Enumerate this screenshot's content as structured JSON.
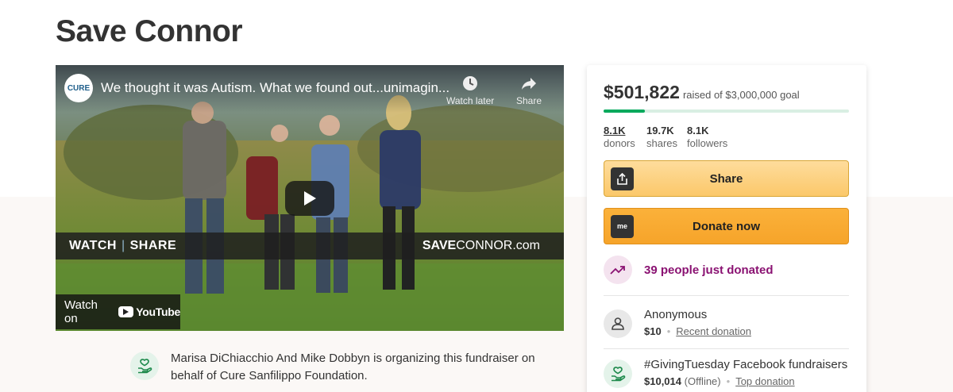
{
  "page": {
    "title": "Save Connor"
  },
  "video": {
    "channel_logo_text": "CURE",
    "title": "We thought it was Autism. What we found out...unimagin...",
    "watch_later": "Watch later",
    "share": "Share",
    "banner_watch": "WATCH",
    "banner_share": "SHARE",
    "banner_site_bold": "SAVE",
    "banner_site_rest": "CONNOR.com",
    "watch_on": "Watch on",
    "youtube": "YouTube"
  },
  "organizer": {
    "text": "Marisa DiChiacchio And Mike Dobbyn is organizing this fundraiser on behalf of Cure Sanfilippo Foundation."
  },
  "sidebar": {
    "raised_amount": "$501,822",
    "goal_text": "raised of $3,000,000 goal",
    "progress_fraction": 0.167,
    "stats": [
      {
        "value": "8.1K",
        "label": "donors"
      },
      {
        "value": "19.7K",
        "label": "shares"
      },
      {
        "value": "8.1K",
        "label": "followers"
      }
    ],
    "share_label": "Share",
    "donate_label": "Donate now",
    "donate_icon_text": "me",
    "recent_count_text": "39 people just donated",
    "donations": [
      {
        "name": "Anonymous",
        "amount": "$10",
        "note": "",
        "tag": "Recent donation"
      },
      {
        "name": "#GivingTuesday Facebook fundraisers",
        "amount": "$10,014",
        "note": "(Offline)",
        "tag": "Top donation"
      }
    ]
  },
  "colors": {
    "brand_green": "#02a95c",
    "share_button": "#fbc86a",
    "donate_button": "#f6a42a",
    "trend_purple": "#8a1272"
  }
}
